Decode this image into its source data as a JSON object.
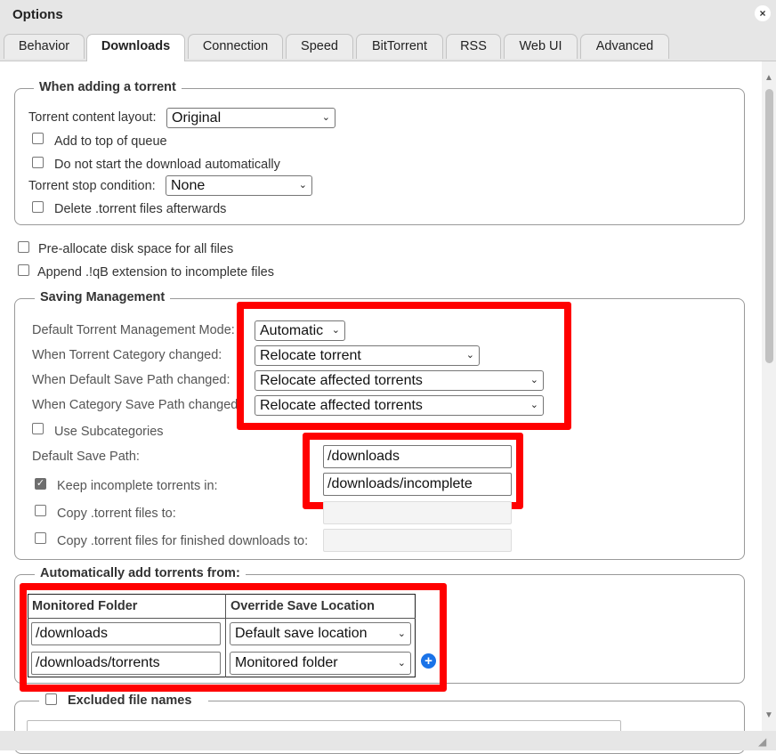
{
  "window": {
    "title": "Options",
    "close_icon": "×"
  },
  "tabs": [
    "Behavior",
    "Downloads",
    "Connection",
    "Speed",
    "BitTorrent",
    "RSS",
    "Web UI",
    "Advanced"
  ],
  "active_tab": "Downloads",
  "adding": {
    "legend": "When adding a torrent",
    "content_layout_label": "Torrent content layout:",
    "content_layout_value": "Original",
    "add_top_label": "Add to top of queue",
    "no_start_label": "Do not start the download automatically",
    "stop_condition_label": "Torrent stop condition:",
    "stop_condition_value": "None",
    "delete_label": "Delete .torrent files afterwards"
  },
  "preallocate_label": "Pre-allocate disk space for all files",
  "append_label": "Append .!qB extension to incomplete files",
  "saving": {
    "legend": "Saving Management",
    "tmm_label": "Default Torrent Management Mode:",
    "tmm_value": "Automatic",
    "category_changed_label": "When Torrent Category changed:",
    "category_changed_value": "Relocate torrent",
    "default_path_changed_label": "When Default Save Path changed:",
    "default_path_changed_value": "Relocate affected torrents",
    "category_path_changed_label": "When Category Save Path changed:",
    "category_path_changed_value": "Relocate affected torrents",
    "subcategories_label": "Use Subcategories",
    "default_save_path_label": "Default Save Path:",
    "default_save_path_value": "/downloads",
    "keep_incomplete_label": "Keep incomplete torrents in:",
    "keep_incomplete_value": "/downloads/incomplete",
    "keep_incomplete_checked": true,
    "copy_label": "Copy .torrent files to:",
    "copy_finished_label": "Copy .torrent files for finished downloads to:"
  },
  "auto_add": {
    "legend": "Automatically add torrents from:",
    "col_folder": "Monitored Folder",
    "col_override": "Override Save Location",
    "rows": [
      {
        "folder": "/downloads",
        "override": "Default save location"
      },
      {
        "folder": "/downloads/torrents",
        "override": "Monitored folder"
      }
    ],
    "add_icon": "+"
  },
  "excluded": {
    "legend": "Excluded file names"
  },
  "colors": {
    "highlight": "#ff0000",
    "add_button": "#1a73e8"
  },
  "icons": {
    "chevron": "⌄",
    "check": "✓",
    "scroll_up": "▲",
    "scroll_down": "▼",
    "resize": "◢"
  }
}
